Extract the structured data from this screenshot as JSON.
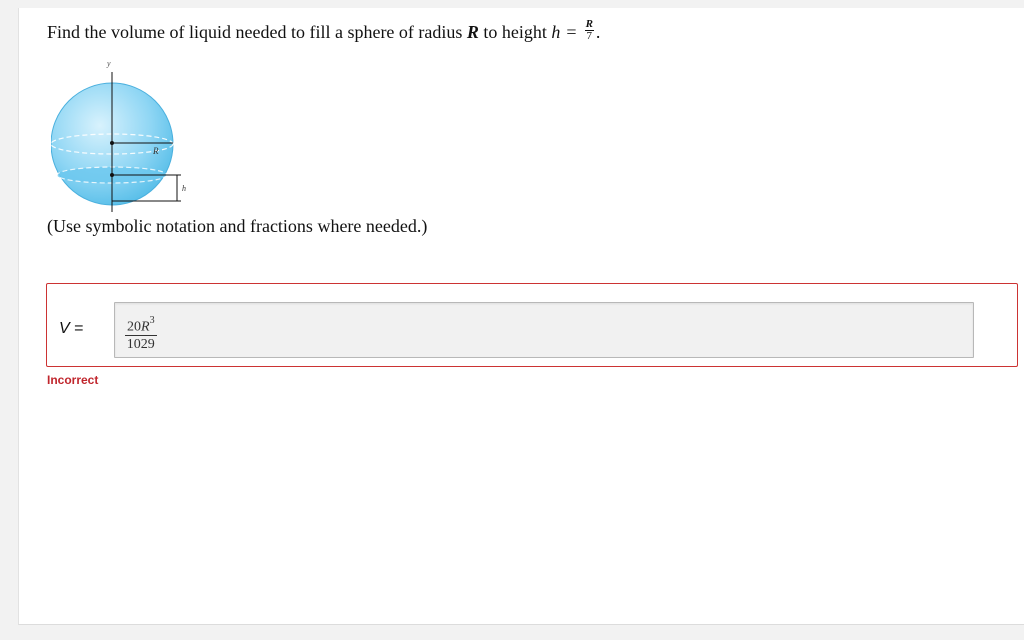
{
  "question": {
    "text": "Find the volume of liquid needed to fill a sphere of radius",
    "radius_var": "R",
    "mid_text": "to height",
    "height_var": "h",
    "equals": "=",
    "frac_num": "R",
    "frac_den": "7",
    "end": "."
  },
  "figure": {
    "y_label": "y",
    "r_label": "R",
    "h_label": "h"
  },
  "hint": "(Use symbolic notation and fractions where needed.)",
  "answer": {
    "label_var": "V",
    "label_eq": "=",
    "value_num_coef": "20",
    "value_num_var": "R",
    "value_num_exp": "3",
    "value_den": "1029"
  },
  "status": {
    "text": "Incorrect",
    "color": "#c0262d"
  },
  "colors": {
    "error_border": "#cc3333",
    "sphere_fill": "#7fd0f2",
    "field_bg": "#f1f1f1"
  }
}
